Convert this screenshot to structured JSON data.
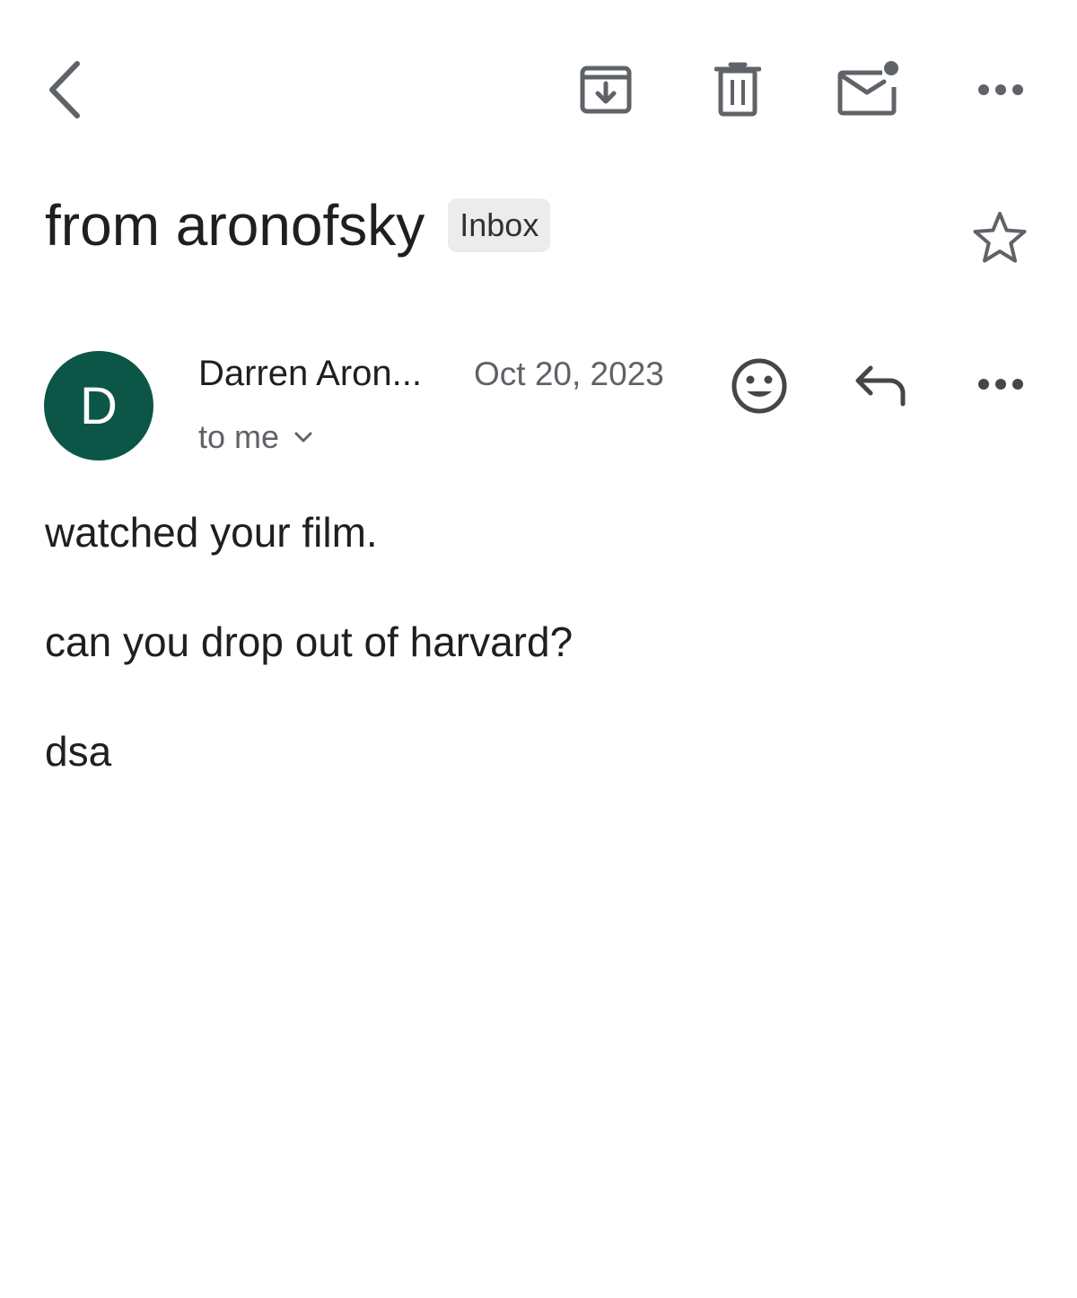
{
  "toolbar": {
    "back_icon": "chevron-left-icon",
    "archive_icon": "archive-icon",
    "delete_icon": "trash-icon",
    "mark_unread_icon": "mark-unread-icon",
    "more_icon": "more-horizontal-icon",
    "icon_color": "#5f6368"
  },
  "thread": {
    "subject": "from aronofsky",
    "label": "Inbox",
    "star_icon": "star-outline-icon"
  },
  "message": {
    "avatar_letter": "D",
    "avatar_color": "#0c5648",
    "sender": "Darren Aron...",
    "date": "Oct 20, 2023",
    "recipient": "to me",
    "recipient_icon": "chevron-down-icon",
    "react_icon": "emoji-icon",
    "reply_icon": "reply-icon",
    "more_icon": "more-horizontal-icon",
    "body": [
      "watched your film.",
      "can you drop out of harvard?",
      "dsa"
    ]
  }
}
